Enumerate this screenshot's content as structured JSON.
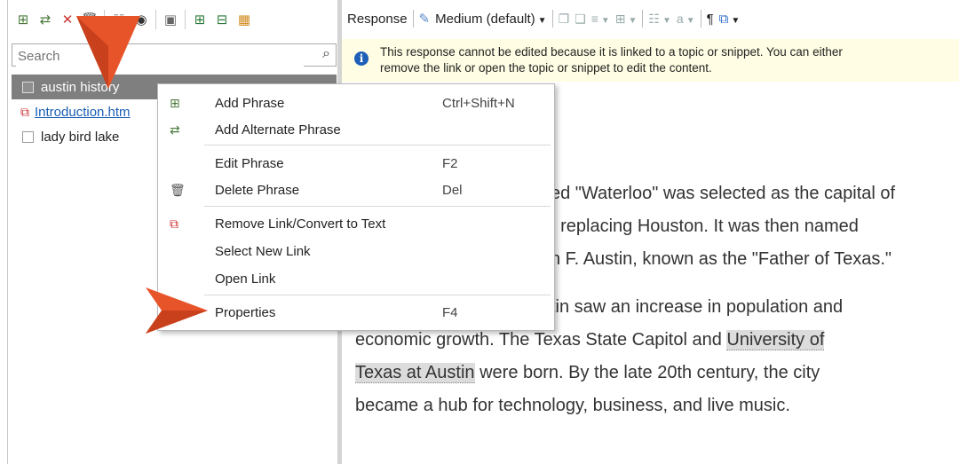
{
  "left_toolbar": {
    "buttons": [
      "add-phrase-icon",
      "add-alternate-phrase-icon",
      "remove-link-icon",
      "delete-icon",
      "page-icon",
      "preview-icon",
      "find-icon",
      "expand-icon",
      "collapse-icon",
      "color-grid-icon"
    ]
  },
  "search": {
    "placeholder": "Search",
    "value": ""
  },
  "tree": {
    "items": [
      {
        "label": "austin history",
        "selected": true,
        "type": "checkbox"
      },
      {
        "label": "Introduction.htm",
        "selected": false,
        "type": "link"
      },
      {
        "label": "lady bird lake",
        "selected": false,
        "type": "checkbox"
      }
    ]
  },
  "right_toolbar": {
    "response_label": "Response",
    "style_label": "Medium (default)",
    "paragraph_symbol": "¶"
  },
  "info_bar": {
    "line1": "This response cannot be edited because it is linked to a topic or snippet. You can either",
    "line2": "remove the link or open the topic or snippet to edit the content."
  },
  "editor": {
    "lines": [
      "ed \"Waterloo\" was selected as the capital of",
      ", replacing Houston. It was then named",
      "n F. Austin, known as the \"Father of Texas.\""
    ],
    "p2_prefix": "stin saw an increase in population and",
    "p2_line2_a": "economic growth. The Texas State Capitol and ",
    "p2_hl1": "University of",
    "p2_hl2": "Texas at Austin",
    "p2_line3_b": " were born. By the late 20th century, the city",
    "p2_line4": "became a hub for technology, business, and live music."
  },
  "context_menu": {
    "items": [
      {
        "label": "Add Phrase",
        "shortcut": "Ctrl+Shift+N",
        "icon": "add-phrase-icon"
      },
      {
        "label": "Add Alternate Phrase",
        "shortcut": "",
        "icon": "add-alternate-phrase-icon"
      },
      {
        "label": "Edit Phrase",
        "shortcut": "F2",
        "icon": ""
      },
      {
        "label": "Delete Phrase",
        "shortcut": "Del",
        "icon": "delete-icon"
      },
      {
        "label": "Remove Link/Convert to Text",
        "shortcut": "",
        "icon": "remove-link-icon"
      },
      {
        "label": "Select New Link",
        "shortcut": "",
        "icon": ""
      },
      {
        "label": "Open Link",
        "shortcut": "",
        "icon": ""
      },
      {
        "label": "Properties",
        "shortcut": "F4",
        "icon": ""
      }
    ]
  },
  "colors": {
    "selection": "#7f7f7f",
    "info_bg": "#fffde3",
    "link": "#1a5fb4",
    "annotation_arrow": "#e8542a",
    "highlight": "#dcdcdc"
  }
}
